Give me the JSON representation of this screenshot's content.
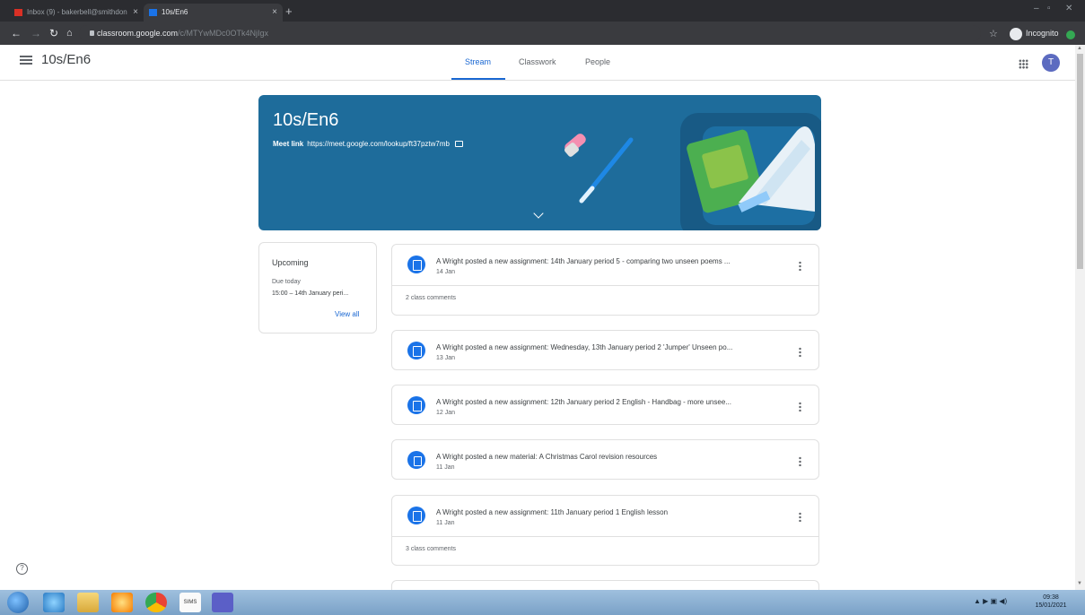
{
  "browser": {
    "tabs": [
      {
        "label": "Inbox (9) - bakerbell@smithdon"
      },
      {
        "label": "10s/En6"
      }
    ],
    "new_tab": "+",
    "url": "classroom.google.com",
    "url_dim": "/c/MTYwMDc0OTk4NjIgx",
    "incognito": "Incognito"
  },
  "header": {
    "class_name": "10s/En6",
    "tabs": [
      "Stream",
      "Classwork",
      "People"
    ],
    "active_tab": "Stream",
    "avatar_letter": "T"
  },
  "banner": {
    "title": "10s/En6",
    "meet_label": "Meet link",
    "meet_url": "https://meet.google.com/lookup/ft37pztw7mb",
    "color": "#1e6c9b"
  },
  "upcoming": {
    "title": "Upcoming",
    "due": "Due today",
    "item": "15:00 – 14th January peri...",
    "view_all": "View all"
  },
  "stream": [
    {
      "title": "A Wright posted a new assignment: 14th January period 5 - comparing two unseen poems ...",
      "date": "14 Jan",
      "comments": "2 class comments",
      "type": "assignment"
    },
    {
      "title": "A Wright posted a new assignment: Wednesday, 13th January period 2 'Jumper' Unseen po...",
      "date": "13 Jan",
      "comments": "",
      "type": "assignment"
    },
    {
      "title": "A Wright posted a new assignment: 12th January period 2 English - Handbag - more unsee...",
      "date": "12 Jan",
      "comments": "",
      "type": "assignment"
    },
    {
      "title": "A Wright posted a new material: A Christmas Carol revision resources",
      "date": "11 Jan",
      "comments": "",
      "type": "material"
    },
    {
      "title": "A Wright posted a new assignment: 11th January period 1 English lesson",
      "date": "11 Jan",
      "comments": "3 class comments",
      "type": "assignment"
    }
  ],
  "taskbar": {
    "sims_label": "SIMS",
    "time": "09:38",
    "date": "15/01/2021"
  },
  "colors": {
    "accent": "#1967d2",
    "icon_blue": "#1a73e8"
  }
}
